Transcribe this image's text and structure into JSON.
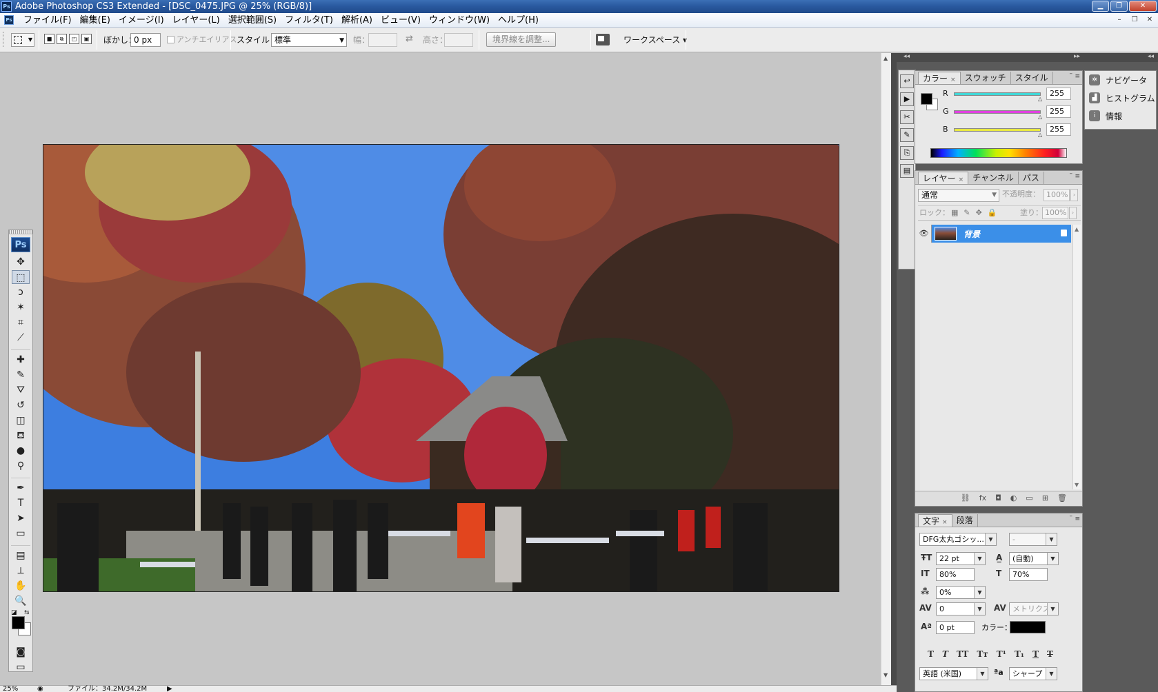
{
  "window": {
    "title": "Adobe Photoshop CS3 Extended - [DSC_0475.JPG @ 25% (RGB/8)]",
    "app_badge": "Ps"
  },
  "menu": {
    "items": [
      "ファイル(F)",
      "編集(E)",
      "イメージ(I)",
      "レイヤー(L)",
      "選択範囲(S)",
      "フィルタ(T)",
      "解析(A)",
      "ビュー(V)",
      "ウィンドウ(W)",
      "ヘルプ(H)"
    ]
  },
  "options": {
    "feather_label": "ぼかし：",
    "feather_value": "0 px",
    "antialias_label": "アンチエイリアス",
    "style_label": "スタイル：",
    "style_value": "標準",
    "width_label": "幅：",
    "height_label": "高さ：",
    "refine_edge_label": "境界線を調整...",
    "workspace_label": "ワークスペース ▾"
  },
  "toolbox": {
    "logo": "Ps",
    "tools": [
      "move",
      "marquee",
      "lasso",
      "magic-wand",
      "crop",
      "slice",
      "healing",
      "brush",
      "stamp",
      "history-brush",
      "eraser",
      "bucket",
      "blur",
      "dodge",
      "pen",
      "type",
      "path-select",
      "shape",
      "notes",
      "eyedropper",
      "hand",
      "zoom"
    ],
    "glyphs": [
      "✥",
      "⬚",
      "ↄ",
      "✶",
      "⌗",
      "⟋",
      "✚",
      "✎",
      "⛛",
      "↺",
      "◫",
      "⛾",
      "●",
      "⚲",
      "✒",
      "T",
      "➤",
      "▭",
      "▤",
      "⟂",
      "✋",
      "🔍"
    ]
  },
  "status": {
    "zoom": "25%",
    "file_info": "ファイル：34.2M/34.2M"
  },
  "color_panel": {
    "tabs": [
      "カラー",
      "スウォッチ",
      "スタイル"
    ],
    "r_label": "R",
    "g_label": "G",
    "b_label": "B",
    "r_value": "255",
    "g_value": "255",
    "b_value": "255",
    "track_colors": [
      "#40d8d8",
      "#e040e0",
      "#e8e840"
    ]
  },
  "layers_panel": {
    "tabs": [
      "レイヤー",
      "チャンネル",
      "パス"
    ],
    "blend_mode": "通常",
    "opacity_label": "不透明度：",
    "opacity_value": "100%",
    "lock_label": "ロック：",
    "fill_label": "塗り：",
    "fill_value": "100%",
    "layer_name": "背景"
  },
  "char_panel": {
    "tabs": [
      "文字",
      "段落"
    ],
    "font_family": "DFG太丸ゴシッ...",
    "font_style": "-",
    "font_size": "22 pt",
    "leading": "(自動)",
    "vert_scale": "80%",
    "horiz_scale": "70%",
    "tsume": "0%",
    "kerning": "0",
    "tracking": "メトリクス",
    "baseline": "0 pt",
    "color_label": "カラー：",
    "language": "英語 (米国)",
    "antialias_label": "ªa",
    "antialias": "シャープ",
    "style_buttons": [
      "T",
      "T",
      "TT",
      "Tт",
      "T¹",
      "T₁",
      "T",
      "T"
    ]
  },
  "nav_panel": {
    "items": [
      {
        "label": "ナビゲータ",
        "icon": "navigator-icon"
      },
      {
        "label": "ヒストグラム",
        "icon": "histogram-icon"
      },
      {
        "label": "情報",
        "icon": "info-icon"
      }
    ]
  }
}
